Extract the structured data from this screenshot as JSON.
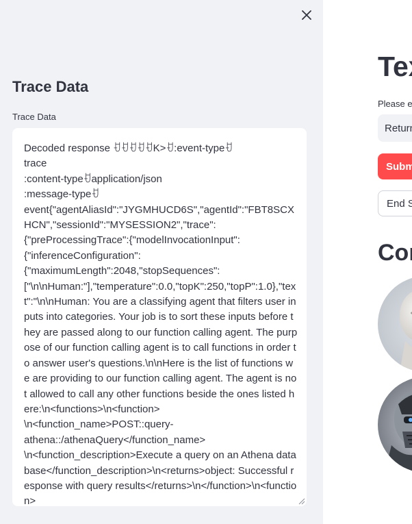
{
  "sidebar": {
    "title": "Trace Data",
    "field_label": "Trace Data",
    "trace_text": "Decoded response ꀀꀀꀀꀀꀀK>ꀀ:event-typeꀀ\ntrace\n:content-typeꀀapplication/json\n:message-typeꀀ\nevent{\"agentAliasId\":\"JYGMHUCD6S\",\"agentId\":\"FBT8SCXHCN\",\"sessionId\":\"MYSESSION2\",\"trace\":\n{\"preProcessingTrace\":{\"modelInvocationInput\":\n{\"inferenceConfiguration\":\n{\"maximumLength\":2048,\"stopSequences\":\n[\"\\n\\nHuman:\"],\"temperature\":0.0,\"topK\":250,\"topP\":1.0},\"text\":\"\\n\\nHuman: You are a classifying agent that filters user inputs into categories. Your job is to sort these inputs before they are passed along to our function calling agent. The purpose of our function calling agent is to call functions in order to answer user's questions.\\n\\nHere is the list of functions we are providing to our function calling agent. The agent is not allowed to call any other functions beside the ones listed here:\\n<functions>\\n<function>\n\\n<function_name>POST::query-\nathena::/athenaQuery</function_name>\n\\n<function_description>Execute a query on an Athena database</function_description>\\n<returns>object: Successful response with query results</returns>\\n</function>\\n<function>"
  },
  "main": {
    "title": "Tex",
    "prompt_label": "Please en",
    "prompt_value": "Return",
    "submit_label": "Subm",
    "end_label": "End S",
    "section_title": "Cor"
  },
  "colors": {
    "sidebar_bg": "#f0f2f6",
    "accent": "#ff4b4b",
    "text": "#31333f"
  }
}
